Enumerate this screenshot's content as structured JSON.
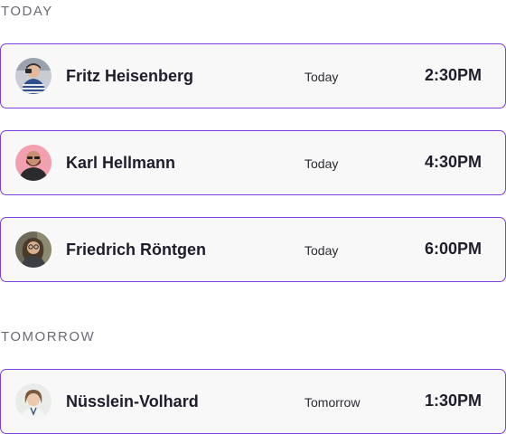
{
  "sections": [
    {
      "label": "TODAY",
      "appointments": [
        {
          "name": "Fritz Heisenberg",
          "day": "Today",
          "time": "2:30PM",
          "avatar": "avatar-photo-man-striped-shirt"
        },
        {
          "name": "Karl Hellmann",
          "day": "Today",
          "time": "4:30PM",
          "avatar": "avatar-photo-bearded-man-pink-bg"
        },
        {
          "name": "Friedrich Röntgen",
          "day": "Today",
          "time": "6:00PM",
          "avatar": "avatar-photo-woman-glasses"
        }
      ]
    },
    {
      "label": "TOMORROW",
      "appointments": [
        {
          "name": "Nüsslein-Volhard",
          "day": "Tomorrow",
          "time": "1:30PM",
          "avatar": "avatar-photo-woman-light-bg"
        }
      ]
    }
  ],
  "colors": {
    "card_border": "#7b3fe4",
    "card_background": "#f8f8f8",
    "section_label": "#6b6b76",
    "text": "#1f1d2b"
  }
}
